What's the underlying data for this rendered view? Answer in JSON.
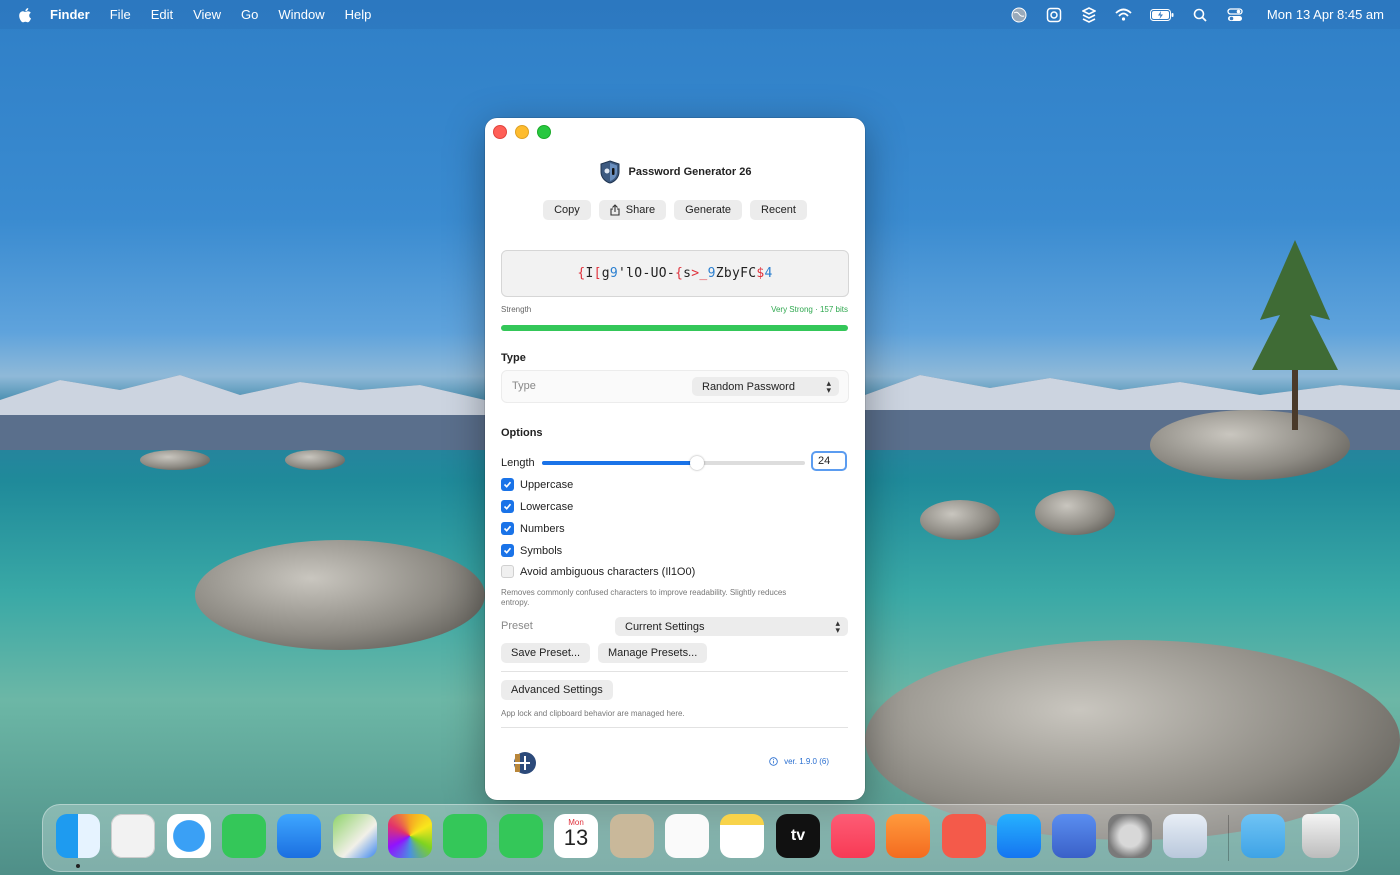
{
  "menubar": {
    "app_name": "Finder",
    "menus": [
      "File",
      "Edit",
      "View",
      "Go",
      "Window",
      "Help"
    ],
    "clock": "Mon 13 Apr  8:45 am",
    "status_icons": [
      "globe-icon",
      "lifebuoy-icon",
      "stack-icon",
      "wifi-icon",
      "battery-icon",
      "search-icon",
      "control-center-icon"
    ]
  },
  "window": {
    "title": "Password Generator 26",
    "toolbar": {
      "copy": "Copy",
      "share": "Share",
      "generate": "Generate",
      "recent": "Recent"
    },
    "password": {
      "value": "{I[g9'lO-UO-{s>_9ZbyFC$4",
      "symbol_color": "#e0323c",
      "number_color": "#2a7fd0"
    },
    "strength": {
      "label": "Strength",
      "value": "Very Strong · 157 bits",
      "level": 1.0,
      "color": "#34c759"
    },
    "type_section": {
      "heading": "Type",
      "label": "Type",
      "selected": "Random Password"
    },
    "options": {
      "heading": "Options",
      "length_label": "Length",
      "length_value": "24",
      "slider_fraction": 0.59,
      "checkboxes": [
        {
          "label": "Uppercase",
          "checked": true
        },
        {
          "label": "Lowercase",
          "checked": true
        },
        {
          "label": "Numbers",
          "checked": true
        },
        {
          "label": "Symbols",
          "checked": true
        },
        {
          "label": "Avoid ambiguous characters (Il1O0)",
          "checked": false
        }
      ],
      "ambiguous_hint": "Removes commonly confused characters to improve readability. Slightly reduces entropy."
    },
    "preset": {
      "label": "Preset",
      "selected": "Current Settings",
      "save_button": "Save Preset...",
      "manage_button": "Manage Presets..."
    },
    "advanced": {
      "button": "Advanced Settings",
      "hint": "App lock and clipboard behavior are managed here."
    },
    "footer": {
      "version": "ver. 1.9.0 (6)"
    }
  },
  "dock": {
    "apps": [
      "finder-icon",
      "launchpad-icon",
      "safari-icon",
      "messages-icon",
      "mail-icon",
      "maps-icon",
      "photos-icon",
      "facetime-icon",
      "phone-icon",
      "calendar-icon",
      "contacts-icon",
      "reminders-icon",
      "notes-icon",
      "tv-icon",
      "music-icon",
      "pages-icon",
      "rocket-icon",
      "app-store-icon",
      "simulator-icon",
      "system-settings-icon",
      "password-generator-icon"
    ],
    "calendar_month": "Mon",
    "calendar_day": "13",
    "tv_label": "tv"
  }
}
